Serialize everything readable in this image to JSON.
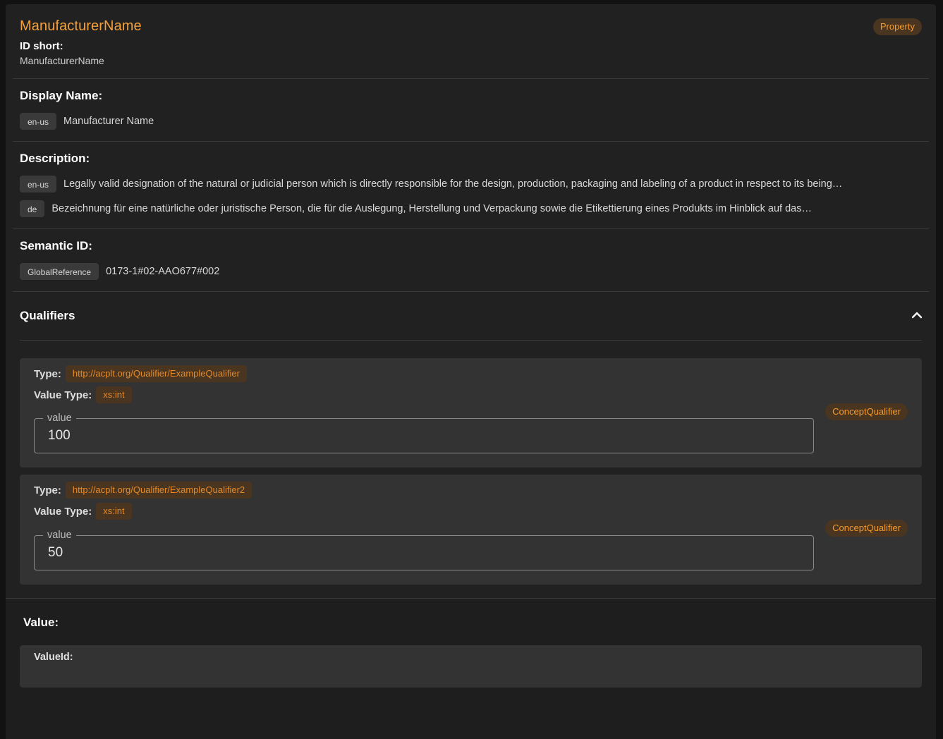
{
  "header": {
    "title": "ManufacturerName",
    "model_type": "Property",
    "id_short_label": "ID short:",
    "id_short_value": "ManufacturerName"
  },
  "display_name": {
    "label": "Display Name:",
    "entries": [
      {
        "lang": "en-us",
        "text": "Manufacturer Name"
      }
    ]
  },
  "description": {
    "label": "Description:",
    "entries": [
      {
        "lang": "en-us",
        "text": "Legally valid designation of the natural or judicial person which is directly responsible for the design, production, packaging and labeling of a product in respect to its being…"
      },
      {
        "lang": "de",
        "text": "Bezeichnung für eine natürliche oder juristische Person, die für die Auslegung, Herstellung und Verpackung sowie die Etikettierung eines Produkts im Hinblick auf das…"
      }
    ]
  },
  "semantic_id": {
    "label": "Semantic ID:",
    "type": "GlobalReference",
    "value": "0173-1#02-AAO677#002"
  },
  "qualifiers": {
    "label": "Qualifiers",
    "expanded": true,
    "items": [
      {
        "type_label": "Type:",
        "type": "http://acplt.org/Qualifier/ExampleQualifier",
        "value_type_label": "Value Type:",
        "value_type": "xs:int",
        "field_label": "value",
        "value": "100",
        "kind": "ConceptQualifier"
      },
      {
        "type_label": "Type:",
        "type": "http://acplt.org/Qualifier/ExampleQualifier2",
        "value_type_label": "Value Type:",
        "value_type": "xs:int",
        "field_label": "value",
        "value": "50",
        "kind": "ConceptQualifier"
      }
    ]
  },
  "value_section": {
    "label": "Value:",
    "value_id_label": "ValueId:"
  },
  "colors": {
    "accent": "#f5a13a",
    "card_bg": "#212121",
    "inner_card_bg": "#333333"
  }
}
